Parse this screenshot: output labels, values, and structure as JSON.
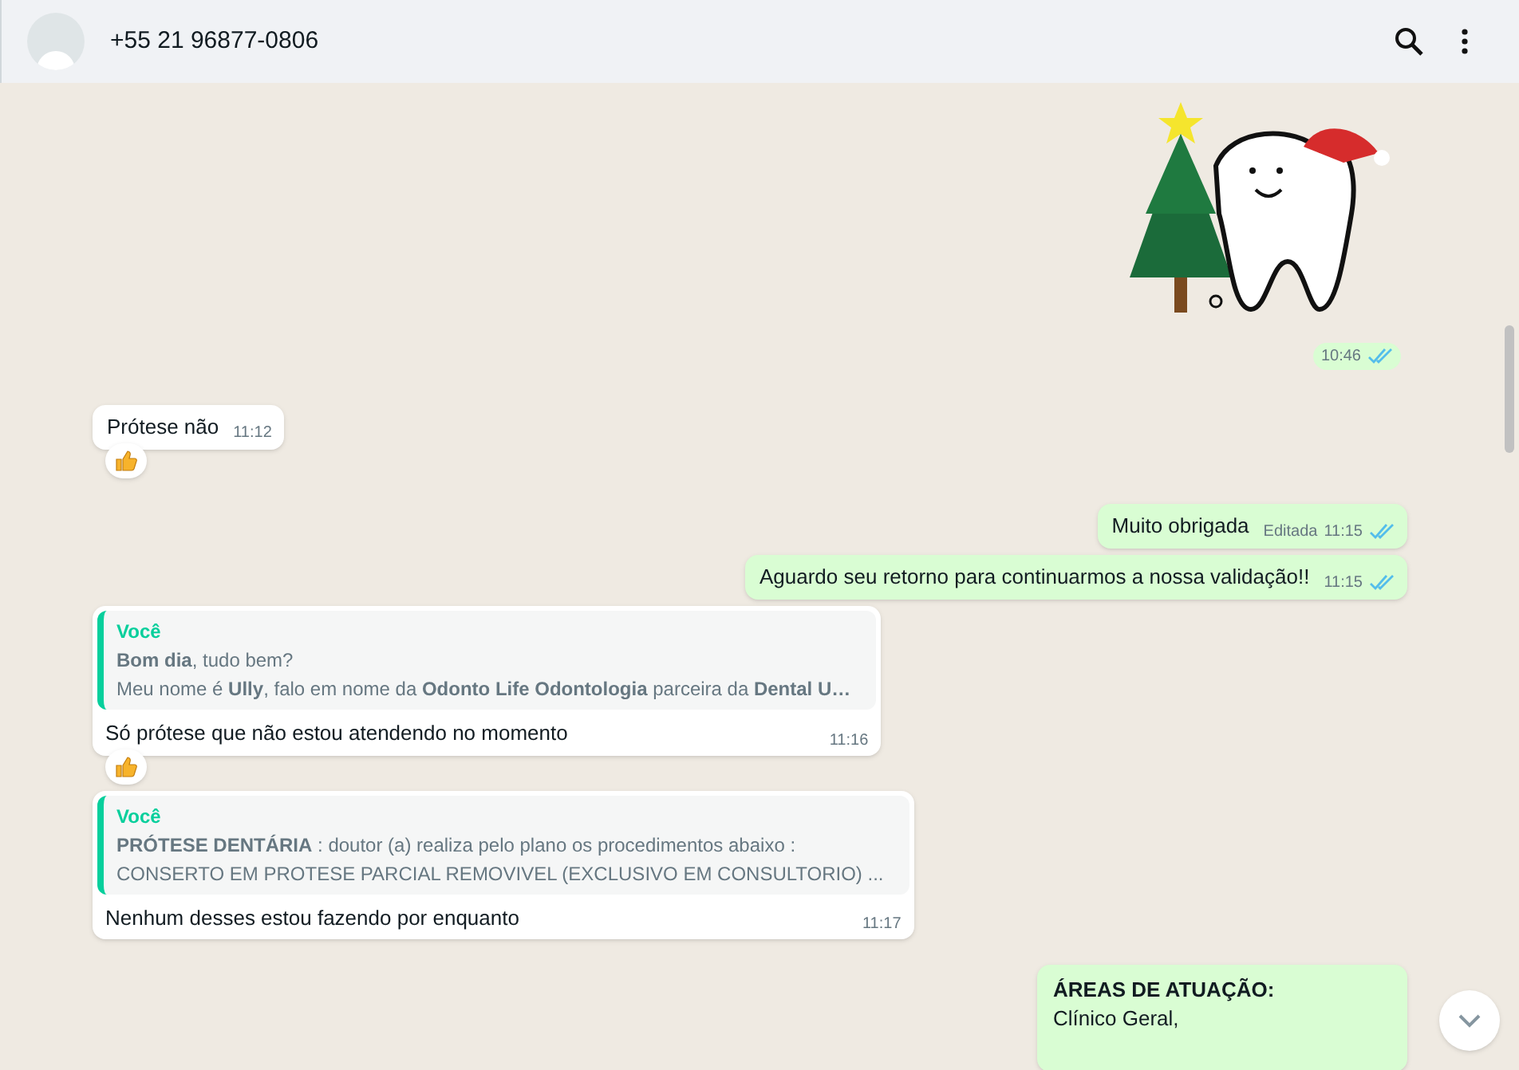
{
  "header": {
    "title": "+55 21 96877-0806"
  },
  "messages": [
    {
      "kind": "sticker",
      "outgoing": true,
      "time": "10:46",
      "read": true
    },
    {
      "kind": "text",
      "outgoing": false,
      "text": "Prótese não",
      "time": "11:12",
      "reaction": true
    },
    {
      "kind": "text",
      "outgoing": true,
      "text": "Muito obrigada",
      "edited": "Editada",
      "time": "11:15",
      "read": true,
      "reaction": false
    },
    {
      "kind": "text",
      "outgoing": true,
      "text": "Aguardo seu retorno para continuarmos a nossa validação!!",
      "time": "11:15",
      "read": true,
      "reaction": false
    },
    {
      "kind": "quoted",
      "outgoing": false,
      "quote_author": "Você",
      "quote_lines": [
        "**Bom dia**, tudo bem?",
        "Meu nome é **Ully**, falo em nome da **Odonto Life Odontologia** parceira da **Dental U…**"
      ],
      "text": "Só prótese que não estou atendendo no momento",
      "time": "11:16",
      "reaction": true
    },
    {
      "kind": "quoted",
      "outgoing": false,
      "quote_author": "Você",
      "quote_lines": [
        "**PRÓTESE DENTÁRIA** : doutor (a) realiza pelo plano os procedimentos abaixo :",
        "CONSERTO EM PROTESE PARCIAL REMOVIVEL (EXCLUSIVO EM CONSULTORIO) ..."
      ],
      "text": "Nenhum desses estou fazendo por enquanto",
      "time": "11:17",
      "reaction": false
    },
    {
      "kind": "lines",
      "outgoing": true,
      "lines": [
        "ÁREAS DE ATUAÇÃO:",
        "Clínico Geral,"
      ]
    }
  ]
}
